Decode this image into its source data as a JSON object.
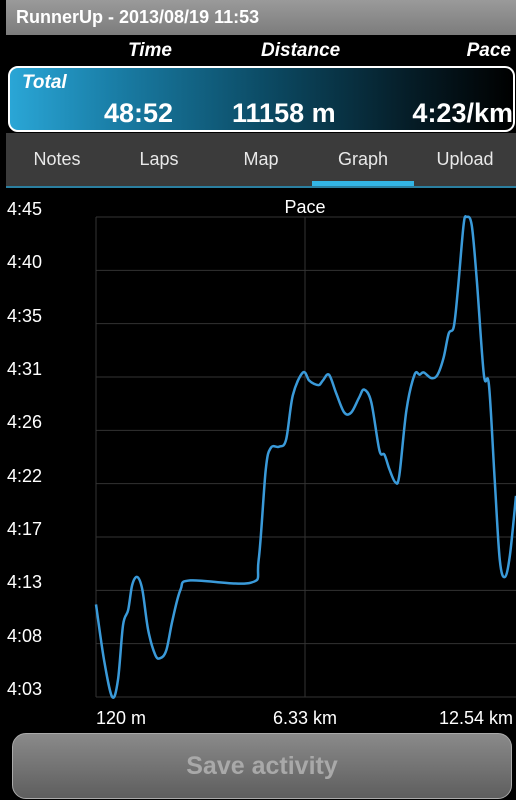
{
  "title_bar": {
    "title": "RunnerUp - 2013/08/19 11:53"
  },
  "summary": {
    "headers": {
      "time": "Time",
      "distance": "Distance",
      "pace": "Pace"
    },
    "total_label": "Total",
    "time": "48:52",
    "distance": "11158 m",
    "pace": "4:23/km"
  },
  "tabs": [
    {
      "label": "Notes",
      "selected": false
    },
    {
      "label": "Laps",
      "selected": false
    },
    {
      "label": "Map",
      "selected": false
    },
    {
      "label": "Graph",
      "selected": true
    },
    {
      "label": "Upload",
      "selected": false
    }
  ],
  "colors": {
    "accent": "#33b5e5",
    "line": "#3a9ad9",
    "grid": "#333333"
  },
  "chart_data": {
    "type": "line",
    "title": "Pace",
    "grid": true,
    "y_ticks": [
      "4:45",
      "4:40",
      "4:35",
      "4:31",
      "4:26",
      "4:22",
      "4:17",
      "4:13",
      "4:08",
      "4:03"
    ],
    "ylim": [
      "4:03",
      "4:45"
    ],
    "x_ticks": [
      "120 m",
      "6.33 km",
      "12.54 km"
    ],
    "xlim_km": [
      0.12,
      12.54
    ],
    "series": [
      {
        "x_km": [
          0.12,
          0.36,
          0.6,
          0.77,
          0.92,
          1.07,
          1.19,
          1.34,
          1.49,
          1.66,
          1.87,
          2.02,
          2.2,
          2.38,
          2.62,
          2.91,
          4.7,
          4.93,
          5.14,
          5.29,
          5.53,
          5.74,
          5.94,
          6.24,
          6.42,
          6.57,
          6.72,
          6.83,
          7.01,
          7.22,
          7.46,
          7.67,
          7.9,
          8.05,
          8.26,
          8.5,
          8.65,
          8.8,
          8.97,
          9.09,
          9.3,
          9.54,
          9.69,
          9.81,
          10.04,
          10.22,
          10.4,
          10.55,
          10.7,
          10.82,
          10.99,
          11.08,
          11.23,
          11.38,
          11.59,
          11.74,
          11.91,
          12.06,
          12.21,
          12.36,
          12.54
        ],
        "pace": [
          "4:11.1",
          "4:06.2",
          "4:03.0",
          "4:04.5",
          "4:09.3",
          "4:10.6",
          "4:12.8",
          "4:13.5",
          "4:12.4",
          "4:08.9",
          "4:06.7",
          "4:06.4",
          "4:07.1",
          "4:09.7",
          "4:12.4",
          "4:13.2",
          "4:13.0",
          "4:15.0",
          "4:22.9",
          "4:24.8",
          "4:24.9",
          "4:25.5",
          "4:29.4",
          "4:31.4",
          "4:30.7",
          "4:30.4",
          "4:30.3",
          "4:30.7",
          "4:31.2",
          "4:29.6",
          "4:27.9",
          "4:27.9",
          "4:29.2",
          "4:29.9",
          "4:28.8",
          "4:24.6",
          "4:24.2",
          "4:22.9",
          "4:21.8",
          "4:22.4",
          "4:28.1",
          "4:31.2",
          "4:31.2",
          "4:31.4",
          "4:30.9",
          "4:31.2",
          "4:32.7",
          "4:34.8",
          "4:35.4",
          "4:38.6",
          "4:44.3",
          "4:45.0",
          "4:44.3",
          "4:39.5",
          "4:31.2",
          "4:30.3",
          "4:22.0",
          "4:15.0",
          "4:13.5",
          "4:15.4",
          "4:20.6"
        ]
      }
    ]
  },
  "save_button": {
    "label": "Save activity",
    "enabled": false
  }
}
